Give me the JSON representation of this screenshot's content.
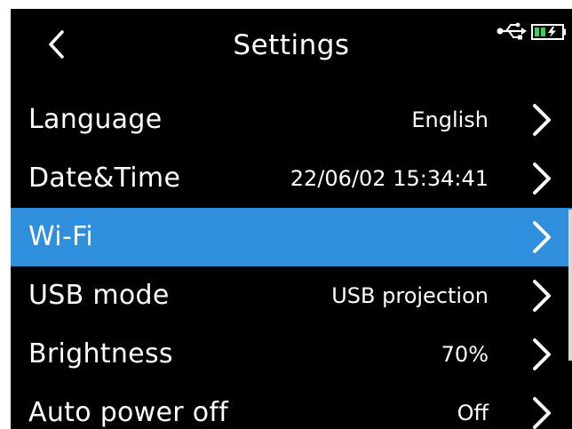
{
  "header": {
    "title": "Settings",
    "back_icon": "chevron-left-icon",
    "status_icons": [
      "usb-icon",
      "battery-charging-icon"
    ]
  },
  "menu": {
    "items": [
      {
        "label": "Language",
        "value": "English",
        "icon": "chevron-right-icon"
      },
      {
        "label": "Date&Time",
        "value": "22/06/02 15:34:41",
        "icon": "chevron-right-icon"
      },
      {
        "label": "Wi-Fi",
        "value": "",
        "icon": "chevron-right-icon",
        "selected": true
      },
      {
        "label": "USB mode",
        "value": "USB projection",
        "icon": "chevron-right-icon"
      },
      {
        "label": "Brightness",
        "value": "70%",
        "icon": "chevron-right-icon"
      },
      {
        "label": "Auto power off",
        "value": "Off",
        "icon": "chevron-right-icon"
      }
    ]
  },
  "colors": {
    "background": "#000000",
    "selected_row": "#2f8fdc",
    "text": "#ffffff",
    "battery": "#39d353"
  }
}
